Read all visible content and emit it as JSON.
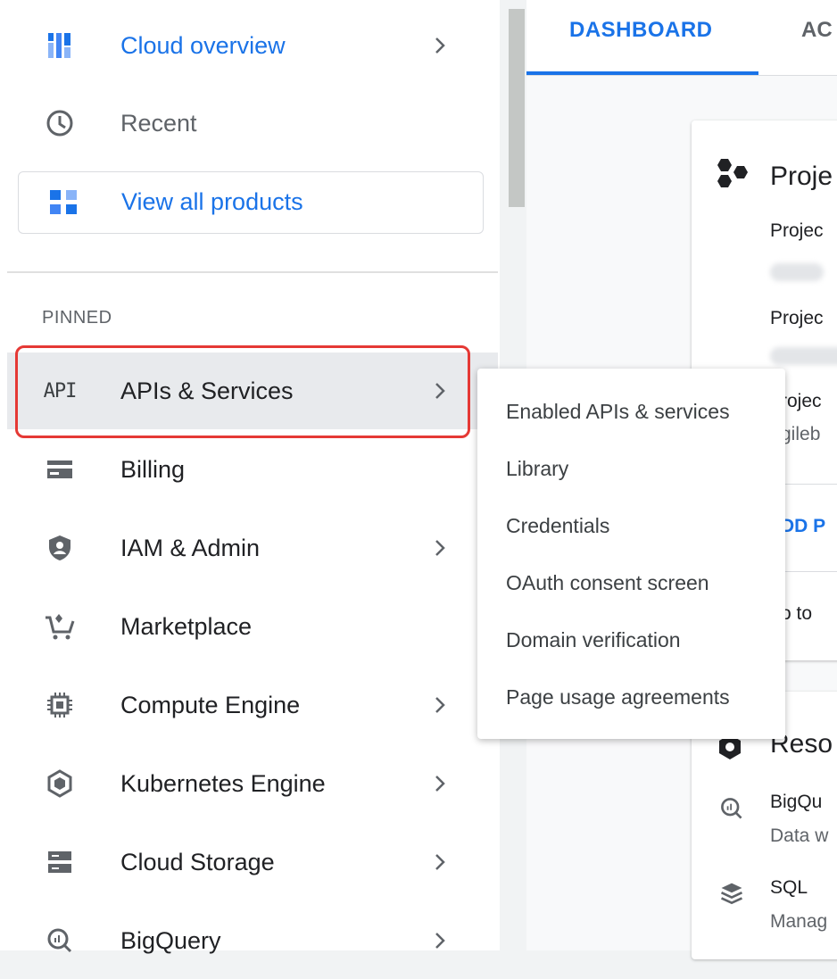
{
  "sidebar": {
    "top_items": [
      {
        "label": "Cloud overview",
        "icon": "dashboard-icon"
      },
      {
        "label": "Recent",
        "icon": "clock-icon"
      }
    ],
    "view_all": {
      "label": "View all products",
      "icon": "grid-icon"
    },
    "pinned_header": "PINNED",
    "pinned_items": [
      {
        "label": "APIs & Services",
        "icon": "api-icon",
        "icon_text": "API"
      },
      {
        "label": "Billing",
        "icon": "billing-icon"
      },
      {
        "label": "IAM & Admin",
        "icon": "shield-icon"
      },
      {
        "label": "Marketplace",
        "icon": "cart-icon"
      },
      {
        "label": "Compute Engine",
        "icon": "chip-icon"
      },
      {
        "label": "Kubernetes Engine",
        "icon": "kubernetes-icon"
      },
      {
        "label": "Cloud Storage",
        "icon": "storage-icon"
      },
      {
        "label": "BigQuery",
        "icon": "bigquery-icon"
      }
    ]
  },
  "flyout": {
    "items": [
      "Enabled APIs & services",
      "Library",
      "Credentials",
      "OAuth consent screen",
      "Domain verification",
      "Page usage agreements"
    ]
  },
  "tabs": {
    "dashboard": "DASHBOARD",
    "activity": "AC"
  },
  "card_project": {
    "title": "Proje",
    "label1": "Projec",
    "label2": "Projec",
    "label3": "rojec",
    "value3": "gileb",
    "add_link": "DD P",
    "go_to": "o to "
  },
  "card_resources": {
    "title": "Reso",
    "items": [
      {
        "name": "BigQu",
        "desc": "Data w",
        "icon": "bigquery-icon"
      },
      {
        "name": "SQL",
        "desc": "Manag",
        "icon": "sql-icon"
      }
    ]
  },
  "colors": {
    "accent": "#1a73e8",
    "highlight": "#e53935",
    "text": "#202124",
    "muted": "#5f6368"
  }
}
